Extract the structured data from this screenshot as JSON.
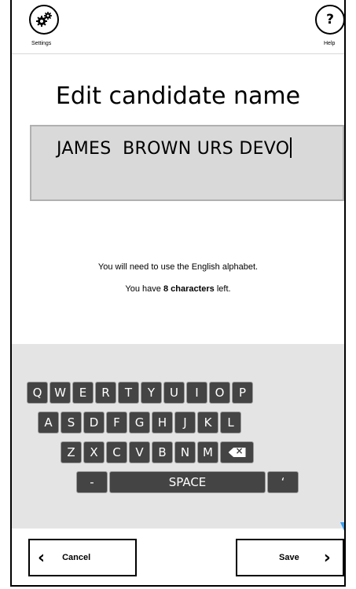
{
  "header": {
    "settings_label": "Settings",
    "help_label": "Help",
    "help_glyph": "?"
  },
  "page": {
    "title": "Edit candidate name",
    "name_value": "JAMES  BROWN URS DEVO",
    "info_line1": "You will need to use the English alphabet.",
    "info_prefix": "You have ",
    "info_bold": "8 characters",
    "info_suffix": " left."
  },
  "keyboard": {
    "row1": [
      "Q",
      "W",
      "E",
      "R",
      "T",
      "Y",
      "U",
      "I",
      "O",
      "P"
    ],
    "row2": [
      "A",
      "S",
      "D",
      "F",
      "G",
      "H",
      "J",
      "K",
      "L"
    ],
    "row3": [
      "Z",
      "X",
      "C",
      "V",
      "B",
      "N",
      "M"
    ],
    "backspace_icon": "backspace-icon",
    "dash": "-",
    "space": "SPACE",
    "apostrophe": "‘"
  },
  "footer": {
    "cancel_label": "Cancel",
    "save_label": "Save"
  },
  "colors": {
    "key_bg": "#444444",
    "keyboard_bg": "#e4e4e4",
    "name_field_bg": "#d9d9d9",
    "annotation_arrow": "#3aa0f0"
  }
}
